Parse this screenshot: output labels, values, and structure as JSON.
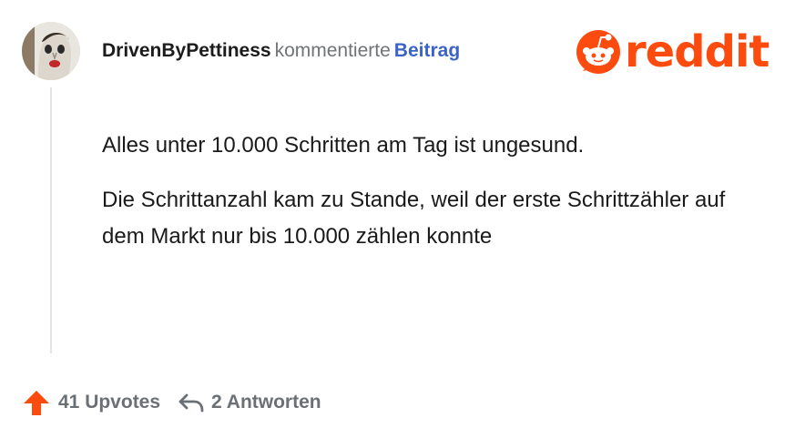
{
  "comment": {
    "username": "DrivenByPettiness",
    "action": "kommentierte",
    "link_text": "Beitrag",
    "paragraphs": [
      "Alles unter 10.000 Schritten am Tag ist ungesund.",
      "Die Schrittanzahl kam zu Stande, weil der erste Schrittzähler auf dem Markt nur bis 10.000 zählen konnte"
    ]
  },
  "brand": {
    "logo_text": "reddit",
    "color": "#fc4b0f"
  },
  "footer": {
    "upvotes_label": "41 Upvotes",
    "replies_label": "2 Antworten",
    "upvote_color": "#fc4b0f"
  },
  "icons": {
    "avatar": "user-avatar",
    "logo": "reddit-snoo-icon",
    "upvote": "upvote-arrow-icon",
    "reply": "reply-arrow-icon"
  }
}
